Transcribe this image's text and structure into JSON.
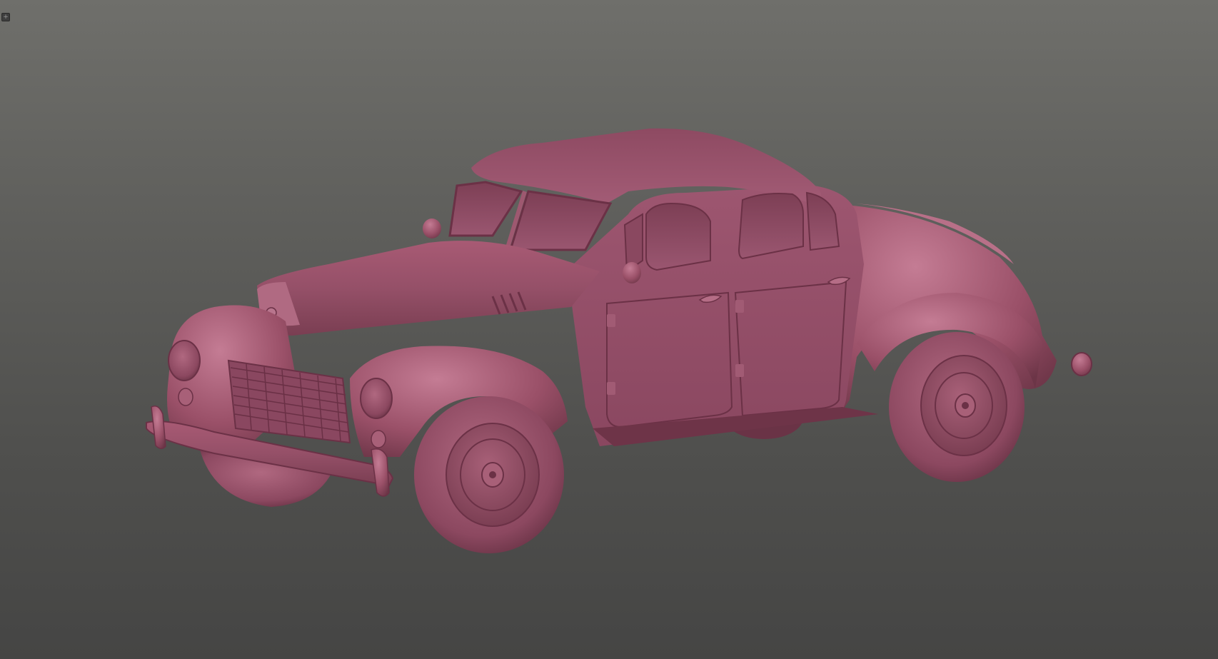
{
  "viewport": {
    "background_top": "#6f6f6b",
    "background_bottom": "#454544"
  },
  "corner_button": {
    "icon": "plus-icon",
    "glyph": "+"
  },
  "model": {
    "name": "",
    "material_color": "#9a5068",
    "highlight_color": "#c07a90",
    "shadow_color": "#5e2c3c"
  }
}
